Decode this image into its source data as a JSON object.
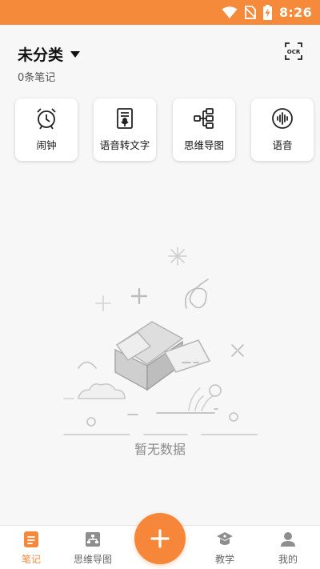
{
  "status_bar": {
    "time": "8:26",
    "icons": [
      "wifi-icon",
      "no-sim-icon",
      "battery-charging-icon"
    ]
  },
  "header": {
    "category_title": "未分类",
    "note_count": "0条笔记",
    "ocr_label": "OCR"
  },
  "tools": [
    {
      "label": "闹钟",
      "icon": "alarm-clock-icon"
    },
    {
      "label": "语音转文字",
      "icon": "voice-to-text-icon"
    },
    {
      "label": "思维导图",
      "icon": "mind-map-icon"
    },
    {
      "label": "语音",
      "icon": "voice-icon"
    }
  ],
  "empty_state": {
    "text": "暂无数据"
  },
  "bottom_nav": {
    "items": [
      {
        "label": "笔记",
        "icon": "note-icon",
        "active": true
      },
      {
        "label": "思维导图",
        "icon": "mind-map-icon",
        "active": false
      },
      {
        "label": "教学",
        "icon": "teaching-icon",
        "active": false
      },
      {
        "label": "我的",
        "icon": "profile-icon",
        "active": false
      }
    ],
    "fab_icon": "plus-icon"
  },
  "colors": {
    "accent": "#f5863a",
    "status_bar": "#f58a3a",
    "background": "#f7f7f7"
  }
}
